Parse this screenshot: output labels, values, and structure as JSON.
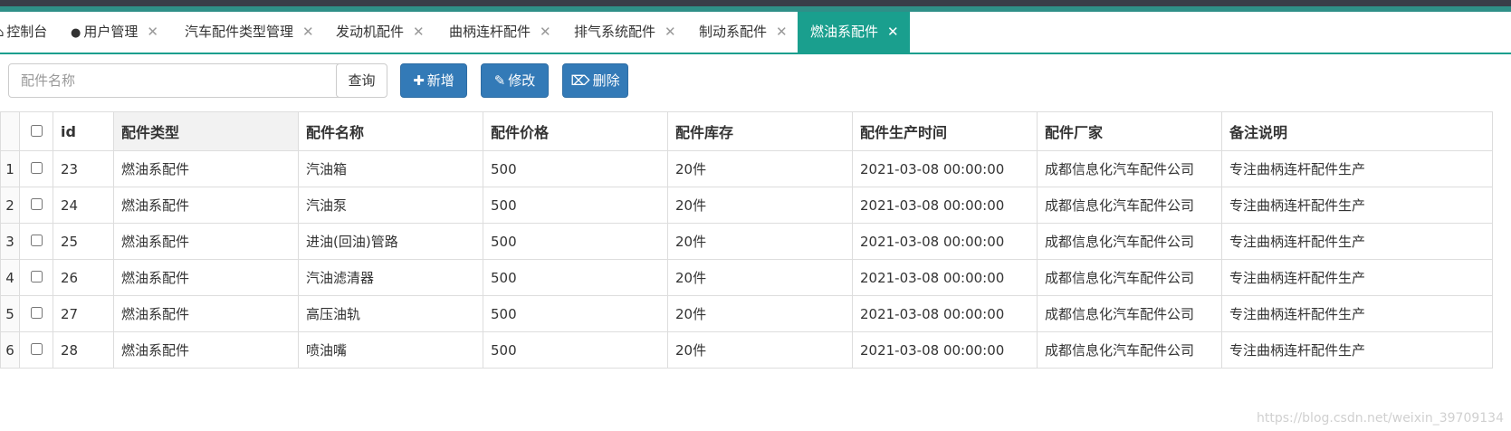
{
  "tabs": [
    {
      "icon": "home-icon",
      "label": "控制台",
      "closable": false
    },
    {
      "icon": "user-icon",
      "label": "用户管理",
      "closable": true
    },
    {
      "icon": "",
      "label": "汽车配件类型管理",
      "closable": true
    },
    {
      "icon": "",
      "label": "发动机配件",
      "closable": true
    },
    {
      "icon": "",
      "label": "曲柄连杆配件",
      "closable": true
    },
    {
      "icon": "",
      "label": "排气系统配件",
      "closable": true
    },
    {
      "icon": "",
      "label": "制动系配件",
      "closable": true
    },
    {
      "icon": "",
      "label": "燃油系配件",
      "closable": true,
      "active": true
    }
  ],
  "close_glyph": "✕",
  "toolbar": {
    "search_placeholder": "配件名称",
    "query_label": "查询",
    "add_label": "新增",
    "edit_label": "修改",
    "delete_label": "删除"
  },
  "table": {
    "columns": [
      "id",
      "配件类型",
      "配件名称",
      "配件价格",
      "配件库存",
      "配件生产时间",
      "配件厂家",
      "备注说明"
    ],
    "rows": [
      {
        "rownum": "1",
        "id": "23",
        "type": "燃油系配件",
        "name": "汽油箱",
        "price": "500",
        "stock": "20件",
        "time": "2021-03-08 00:00:00",
        "maker": "成都信息化汽车配件公司",
        "note": "专注曲柄连杆配件生产"
      },
      {
        "rownum": "2",
        "id": "24",
        "type": "燃油系配件",
        "name": "汽油泵",
        "price": "500",
        "stock": "20件",
        "time": "2021-03-08 00:00:00",
        "maker": "成都信息化汽车配件公司",
        "note": "专注曲柄连杆配件生产"
      },
      {
        "rownum": "3",
        "id": "25",
        "type": "燃油系配件",
        "name": "进油(回油)管路",
        "price": "500",
        "stock": "20件",
        "time": "2021-03-08 00:00:00",
        "maker": "成都信息化汽车配件公司",
        "note": "专注曲柄连杆配件生产"
      },
      {
        "rownum": "4",
        "id": "26",
        "type": "燃油系配件",
        "name": "汽油滤清器",
        "price": "500",
        "stock": "20件",
        "time": "2021-03-08 00:00:00",
        "maker": "成都信息化汽车配件公司",
        "note": "专注曲柄连杆配件生产"
      },
      {
        "rownum": "5",
        "id": "27",
        "type": "燃油系配件",
        "name": "高压油轨",
        "price": "500",
        "stock": "20件",
        "time": "2021-03-08 00:00:00",
        "maker": "成都信息化汽车配件公司",
        "note": "专注曲柄连杆配件生产"
      },
      {
        "rownum": "6",
        "id": "28",
        "type": "燃油系配件",
        "name": "喷油嘴",
        "price": "500",
        "stock": "20件",
        "time": "2021-03-08 00:00:00",
        "maker": "成都信息化汽车配件公司",
        "note": "专注曲柄连杆配件生产"
      }
    ]
  },
  "watermark": "https://blog.csdn.net/weixin_39709134",
  "colors": {
    "active_tab": "#1a9f8e",
    "primary_button": "#337ab7",
    "top_bar": "#393d49"
  }
}
